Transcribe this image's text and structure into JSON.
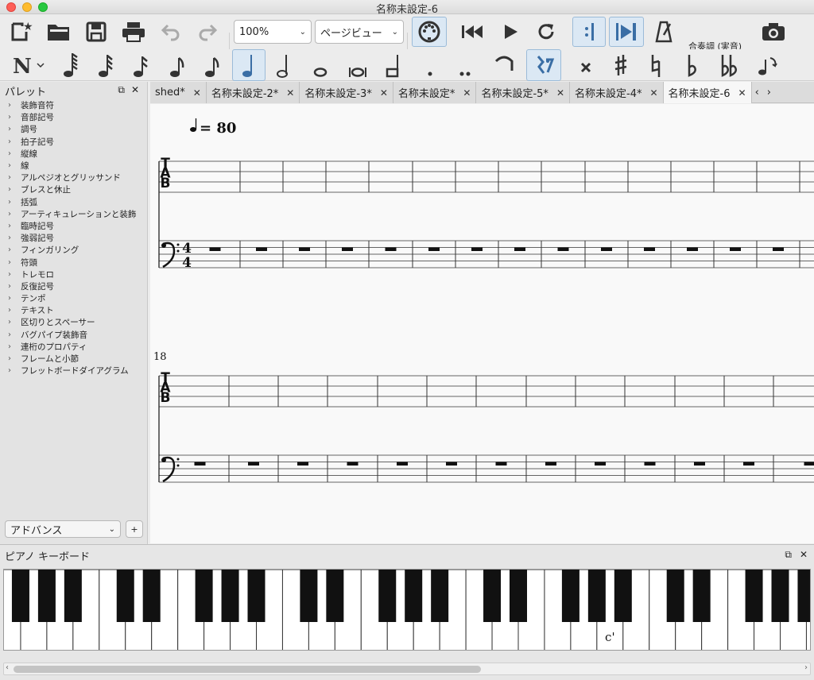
{
  "window": {
    "title": "名称未設定-6"
  },
  "toolbar": {
    "zoom": "100%",
    "view_mode": "ページビュー",
    "concert_pitch": "合奏調 (実音)"
  },
  "palette": {
    "title": "パレット",
    "items": [
      "装飾音符",
      "音部記号",
      "調号",
      "拍子記号",
      "縦線",
      "線",
      "アルペジオとグリッサンド",
      "ブレスと休止",
      "括弧",
      "アーティキュレーションと装飾",
      "臨時記号",
      "強弱記号",
      "フィンガリング",
      "符頭",
      "トレモロ",
      "反復記号",
      "テンポ",
      "テキスト",
      "区切りとスペーサー",
      "バグパイプ装飾音",
      "連桁のプロパティ",
      "フレームと小節",
      "フレットボードダイアグラム"
    ],
    "workspace": "アドバンス",
    "add": "+"
  },
  "tabs": [
    {
      "label": "shed*",
      "active": false
    },
    {
      "label": "名称未設定-2*",
      "active": false
    },
    {
      "label": "名称未設定-3*",
      "active": false
    },
    {
      "label": "名称未設定*",
      "active": false
    },
    {
      "label": "名称未設定-5*",
      "active": false
    },
    {
      "label": "名称未設定-4*",
      "active": false
    },
    {
      "label": "名称未設定-6",
      "active": true
    }
  ],
  "score": {
    "tempo_text": "= 80",
    "system2_measure": "18",
    "tab_clef": [
      "T",
      "A",
      "B"
    ],
    "time_signature": [
      "4",
      "4"
    ]
  },
  "piano": {
    "title": "ピアノ キーボード",
    "middle_c_label": "c'"
  }
}
